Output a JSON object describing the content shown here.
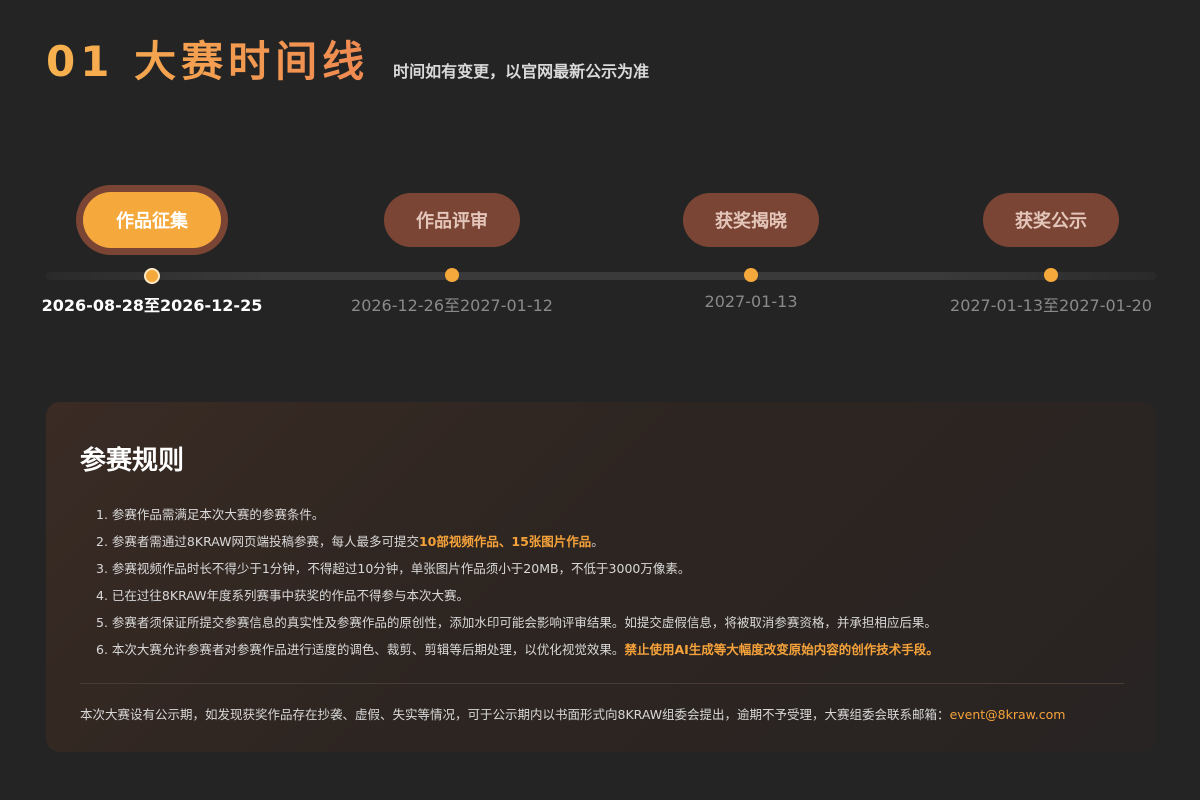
{
  "header": {
    "title": "01 大赛时间线",
    "subtitle": "时间如有变更，以官网最新公示为准"
  },
  "timeline": {
    "stages": [
      {
        "label": "作品征集",
        "date": "2026-08-28至2026-12-25",
        "active": true
      },
      {
        "label": "作品评审",
        "date": "2026-12-26至2027-01-12",
        "active": false
      },
      {
        "label": "获奖揭晓",
        "date": "2027-01-13",
        "active": false
      },
      {
        "label": "获奖公示",
        "date": "2027-01-13至2027-01-20",
        "active": false
      }
    ]
  },
  "rules": {
    "title": "参赛规则",
    "items": [
      {
        "num": "1.",
        "text": "参赛作品需满足本次大赛的参赛条件。",
        "highlight": "",
        "suffix": ""
      },
      {
        "num": "2.",
        "text": "参赛者需通过8KRAW网页端投稿参赛，每人最多可提交",
        "highlight": "10部视频作品、15张图片作品",
        "suffix": "。"
      },
      {
        "num": "3.",
        "text": "参赛视频作品时长不得少于1分钟，不得超过10分钟，单张图片作品须小于20MB，不低于3000万像素。",
        "highlight": "",
        "suffix": ""
      },
      {
        "num": "4.",
        "text": "已在过往8KRAW年度系列赛事中获奖的作品不得参与本次大赛。",
        "highlight": "",
        "suffix": ""
      },
      {
        "num": "5.",
        "text": "参赛者须保证所提交参赛信息的真实性及参赛作品的原创性，添加水印可能会影响评审结果。如提交虚假信息，将被取消参赛资格，并承担相应后果。",
        "highlight": "",
        "suffix": ""
      },
      {
        "num": "6.",
        "text": "本次大赛允许参赛者对参赛作品进行适度的调色、裁剪、剪辑等后期处理，以优化视觉效果。",
        "highlight": "禁止使用AI生成等大幅度改变原始内容的创作技术手段。",
        "suffix": ""
      }
    ],
    "footer_text": "本次大赛设有公示期，如发现获奖作品存在抄袭、虚假、失实等情况，可于公示期内以书面形式向8KRAW组委会提出，逾期不予受理，大赛组委会联系邮箱：",
    "email": "event@8kraw.com"
  },
  "colors": {
    "accent": "#f5a83c",
    "pill_inactive": "#7a4534",
    "background": "#242424"
  }
}
